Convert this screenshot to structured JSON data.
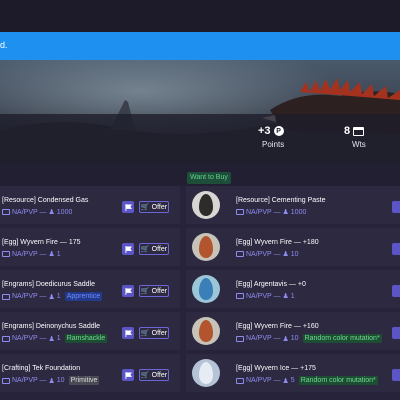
{
  "alert": {
    "text": "d."
  },
  "stats": {
    "points_value": "+3",
    "points_label": "Points",
    "wts_value": "8",
    "wts_label": "Wts"
  },
  "section": {
    "want_to_buy": "Want to Buy"
  },
  "left_items": [
    {
      "title": "[Resource] Condensed Gas",
      "server": "NA/PVP —",
      "qty": "1000",
      "tag": ""
    },
    {
      "title": "[Egg] Wyvern Fire — 175",
      "server": "NA/PVP —",
      "qty": "1",
      "tag": ""
    },
    {
      "title": "[Engrams] Doedicurus Saddle",
      "server": "NA/PVP —",
      "qty": "1",
      "tag": "Apprentice"
    },
    {
      "title": "[Engrams] Deinonychus Saddle",
      "server": "NA/PVP —",
      "qty": "1",
      "tag": "Ramshackle"
    },
    {
      "title": "[Crafting] Tek Foundation",
      "server": "NA/PVP —",
      "qty": "10",
      "tag": "Primitive"
    }
  ],
  "right_items": [
    {
      "title": "[Resource] Cementing Paste",
      "server": "NA/PVP —",
      "qty": "1000",
      "tag": ""
    },
    {
      "title": "[Egg] Wyvern Fire — +180",
      "server": "NA/PVP —",
      "qty": "10",
      "tag": ""
    },
    {
      "title": "[Egg] Argentavis — +0",
      "server": "NA/PVP —",
      "qty": "1",
      "tag": ""
    },
    {
      "title": "[Egg] Wyvern Fire — +160",
      "server": "NA/PVP —",
      "qty": "10",
      "tag": "Random color mutation*"
    },
    {
      "title": "[Egg] Wyvern Ice — +175",
      "server": "NA/PVP —",
      "qty": "5",
      "tag": "Random color mutation*"
    }
  ],
  "buttons": {
    "offer_label": "Offer"
  },
  "colors": {
    "accent": "#5b55c7",
    "alert": "#1e90f0",
    "background": "#26233a"
  }
}
